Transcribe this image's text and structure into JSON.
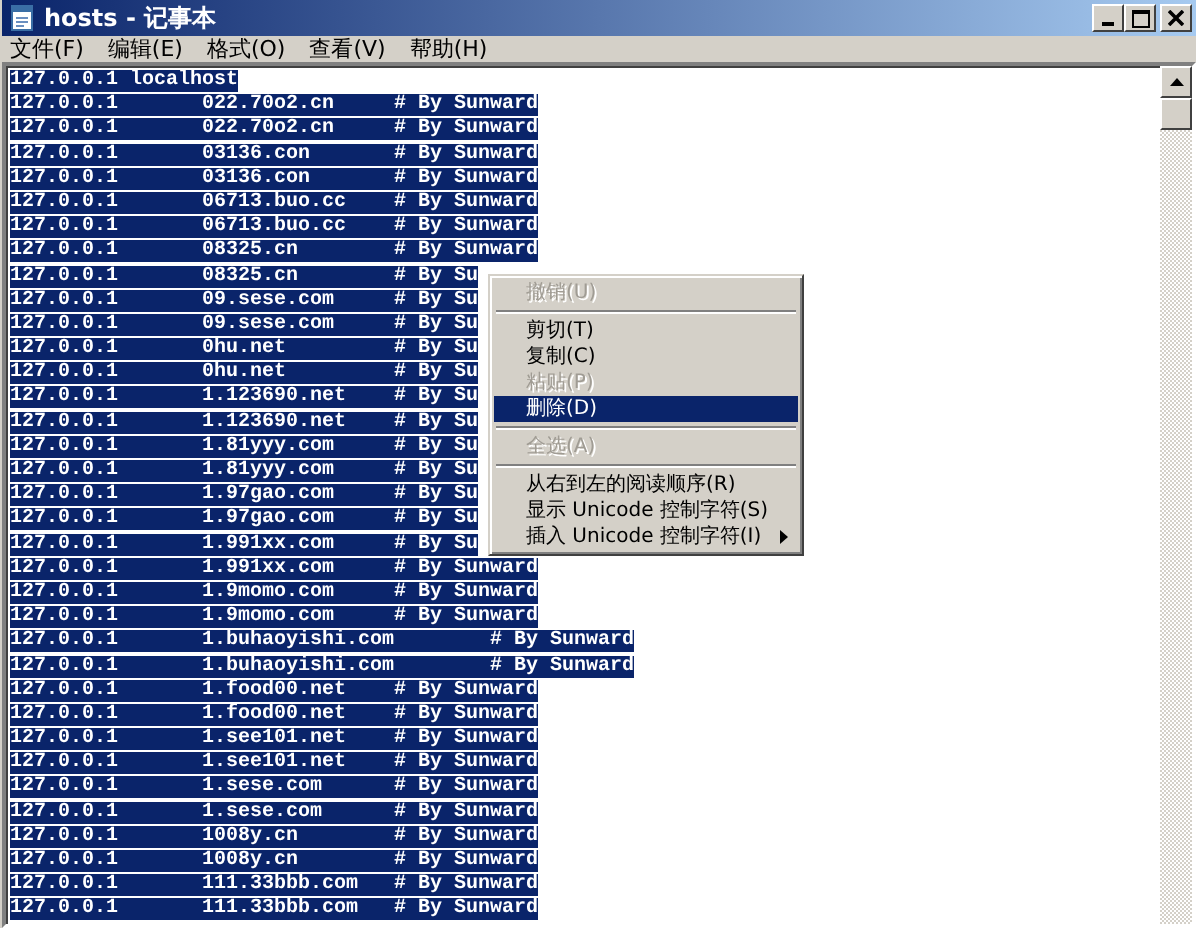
{
  "window": {
    "title": "hosts - 记事本"
  },
  "menu_bar": [
    {
      "label": "文件(F)"
    },
    {
      "label": "编辑(E)"
    },
    {
      "label": "格式(O)"
    },
    {
      "label": "查看(V)"
    },
    {
      "label": "帮助(H)"
    }
  ],
  "editor": {
    "lines": [
      {
        "text": "127.0.0.1 localhost",
        "selected": true
      },
      {
        "text": "127.0.0.1\t022.70o2.cn\t# By Sunward",
        "selected": true
      },
      {
        "text": "127.0.0.1\t022.70o2.cn\t# By Sunward",
        "selected": true
      },
      {
        "text": "127.0.0.1\t03136.con\t# By Sunward",
        "selected": true
      },
      {
        "text": "127.0.0.1\t03136.con\t# By Sunward",
        "selected": true
      },
      {
        "text": "127.0.0.1\t06713.buo.cc\t# By Sunward",
        "selected": true
      },
      {
        "text": "127.0.0.1\t06713.buo.cc\t# By Sunward",
        "selected": true
      },
      {
        "text": "127.0.0.1\t08325.cn\t# By Sunward",
        "selected": true
      },
      {
        "text": "127.0.0.1\t08325.cn\t# By Su",
        "selected": true
      },
      {
        "text": "127.0.0.1\t09.sese.com\t# By Su",
        "selected": true
      },
      {
        "text": "127.0.0.1\t09.sese.com\t# By Su",
        "selected": true
      },
      {
        "text": "127.0.0.1\t0hu.net\t\t# By Su",
        "selected": true
      },
      {
        "text": "127.0.0.1\t0hu.net\t\t# By Su",
        "selected": true
      },
      {
        "text": "127.0.0.1\t1.123690.net\t# By Su",
        "selected": true
      },
      {
        "text": "127.0.0.1\t1.123690.net\t# By Su",
        "selected": true
      },
      {
        "text": "127.0.0.1\t1.81yyy.com\t# By Su",
        "selected": true
      },
      {
        "text": "127.0.0.1\t1.81yyy.com\t# By Su",
        "selected": true
      },
      {
        "text": "127.0.0.1\t1.97gao.com\t# By Su",
        "selected": true
      },
      {
        "text": "127.0.0.1\t1.97gao.com\t# By Su",
        "selected": true
      },
      {
        "text": "127.0.0.1\t1.991xx.com\t# By Su",
        "selected": true
      },
      {
        "text": "127.0.0.1\t1.991xx.com\t# By Sunward",
        "selected": true
      },
      {
        "text": "127.0.0.1\t1.9momo.com\t# By Sunward",
        "selected": true
      },
      {
        "text": "127.0.0.1\t1.9momo.com\t# By Sunward",
        "selected": true
      },
      {
        "text": "127.0.0.1\t1.buhaoyishi.com\t# By Sunward",
        "selected": true
      },
      {
        "text": "127.0.0.1\t1.buhaoyishi.com\t# By Sunward",
        "selected": true
      },
      {
        "text": "127.0.0.1\t1.food00.net\t# By Sunward",
        "selected": true
      },
      {
        "text": "127.0.0.1\t1.food00.net\t# By Sunward",
        "selected": true
      },
      {
        "text": "127.0.0.1\t1.see101.net\t# By Sunward",
        "selected": true
      },
      {
        "text": "127.0.0.1\t1.see101.net\t# By Sunward",
        "selected": true
      },
      {
        "text": "127.0.0.1\t1.sese.com\t# By Sunward",
        "selected": true
      },
      {
        "text": "127.0.0.1\t1.sese.com\t# By Sunward",
        "selected": true
      },
      {
        "text": "127.0.0.1\t1008y.cn\t# By Sunward",
        "selected": true
      },
      {
        "text": "127.0.0.1\t1008y.cn\t# By Sunward",
        "selected": true
      },
      {
        "text": "127.0.0.1\t111.33bbb.com\t# By Sunward",
        "selected": true
      },
      {
        "text": "127.0.0.1\t111.33bbb.com\t# By Sunward",
        "selected": true
      }
    ]
  },
  "context_menu": {
    "items": [
      {
        "kind": "item",
        "label": "撤销(U)",
        "disabled": true,
        "selected": false
      },
      {
        "kind": "separator"
      },
      {
        "kind": "item",
        "label": "剪切(T)",
        "disabled": false,
        "selected": false
      },
      {
        "kind": "item",
        "label": "复制(C)",
        "disabled": false,
        "selected": false
      },
      {
        "kind": "item",
        "label": "粘贴(P)",
        "disabled": true,
        "selected": false
      },
      {
        "kind": "item",
        "label": "删除(D)",
        "disabled": false,
        "selected": true
      },
      {
        "kind": "separator"
      },
      {
        "kind": "item",
        "label": "全选(A)",
        "disabled": true,
        "selected": false
      },
      {
        "kind": "separator"
      },
      {
        "kind": "item",
        "label": "从右到左的阅读顺序(R)",
        "disabled": false,
        "selected": false
      },
      {
        "kind": "item",
        "label": "显示 Unicode 控制字符(S)",
        "disabled": false,
        "selected": false
      },
      {
        "kind": "submenu",
        "label": "插入 Unicode 控制字符(I)",
        "disabled": false,
        "selected": false
      }
    ]
  }
}
